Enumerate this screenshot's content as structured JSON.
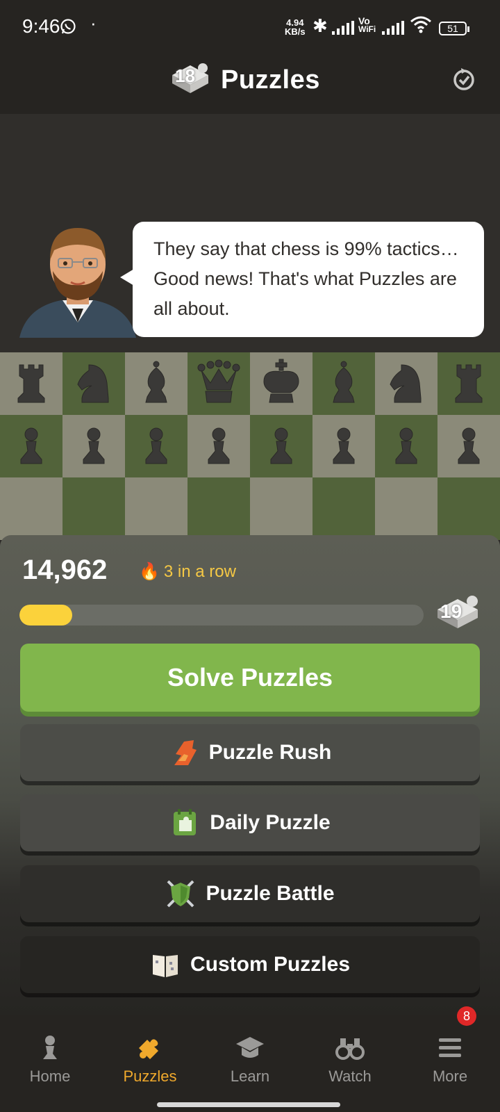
{
  "status_bar": {
    "time": "9:46",
    "net_speed_value": "4.94",
    "net_speed_unit": "KB/s",
    "vo_label": "Vo",
    "wifi_label": "WiFi",
    "battery": "51"
  },
  "header": {
    "badge_number": "18",
    "title": "Puzzles"
  },
  "coach": {
    "message": "They say that chess is 99% tactics… Good news! That's what Puzzles are all about."
  },
  "board": {
    "rows": [
      [
        "rook",
        "knight",
        "bishop",
        "queen",
        "king",
        "bishop",
        "knight",
        "rook"
      ],
      [
        "pawn",
        "pawn",
        "pawn",
        "pawn",
        "pawn",
        "pawn",
        "pawn",
        "pawn"
      ],
      [
        "",
        "",
        "",
        "",
        "",
        "",
        "",
        ""
      ]
    ],
    "colors": {
      "light": "#8b8a79",
      "dark": "#52633a"
    }
  },
  "stats": {
    "rating": "14,962",
    "streak": "3 in a row",
    "progress_fraction": 0.13,
    "next_badge": "19"
  },
  "buttons": {
    "solve": "Solve Puzzles",
    "rush": "Puzzle Rush",
    "daily": "Daily Puzzle",
    "battle": "Puzzle Battle",
    "custom": "Custom Puzzles"
  },
  "nav": {
    "items": [
      {
        "label": "Home",
        "icon": "pawn-icon"
      },
      {
        "label": "Puzzles",
        "icon": "puzzle-piece-icon",
        "active": true
      },
      {
        "label": "Learn",
        "icon": "graduation-cap-icon"
      },
      {
        "label": "Watch",
        "icon": "binoculars-icon"
      },
      {
        "label": "More",
        "icon": "menu-icon",
        "badge": "8"
      }
    ]
  },
  "colors": {
    "accent_green": "#81b64c",
    "accent_orange": "#f0a92c",
    "progress_yellow": "#fbd23b"
  }
}
